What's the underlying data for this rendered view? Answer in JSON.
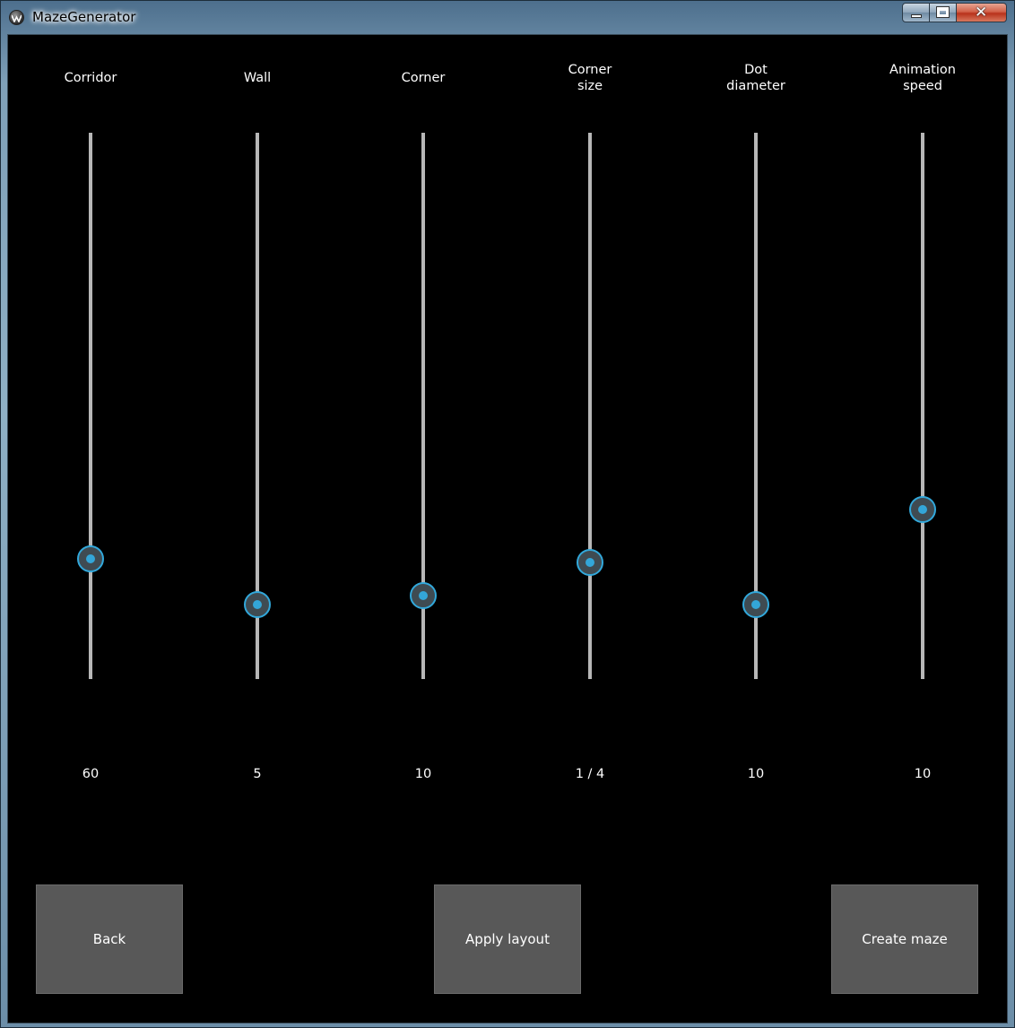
{
  "window": {
    "title": "MazeGenerator"
  },
  "sliders": [
    {
      "label": "Corridor",
      "value_text": "60",
      "position": 0.22
    },
    {
      "label": "Wall",
      "value_text": "5",
      "position": 0.137
    },
    {
      "label": "Corner",
      "value_text": "10",
      "position": 0.152
    },
    {
      "label": "Corner\nsize",
      "value_text": "1 / 4",
      "position": 0.213
    },
    {
      "label": "Dot\ndiameter",
      "value_text": "10",
      "position": 0.137
    },
    {
      "label": "Animation\nspeed",
      "value_text": "10",
      "position": 0.31
    }
  ],
  "buttons": {
    "back": "Back",
    "apply": "Apply layout",
    "create": "Create maze"
  },
  "colors": {
    "accent": "#33a6d8",
    "track": "#b7b7b7",
    "button_bg": "#585858",
    "background": "#000000"
  }
}
